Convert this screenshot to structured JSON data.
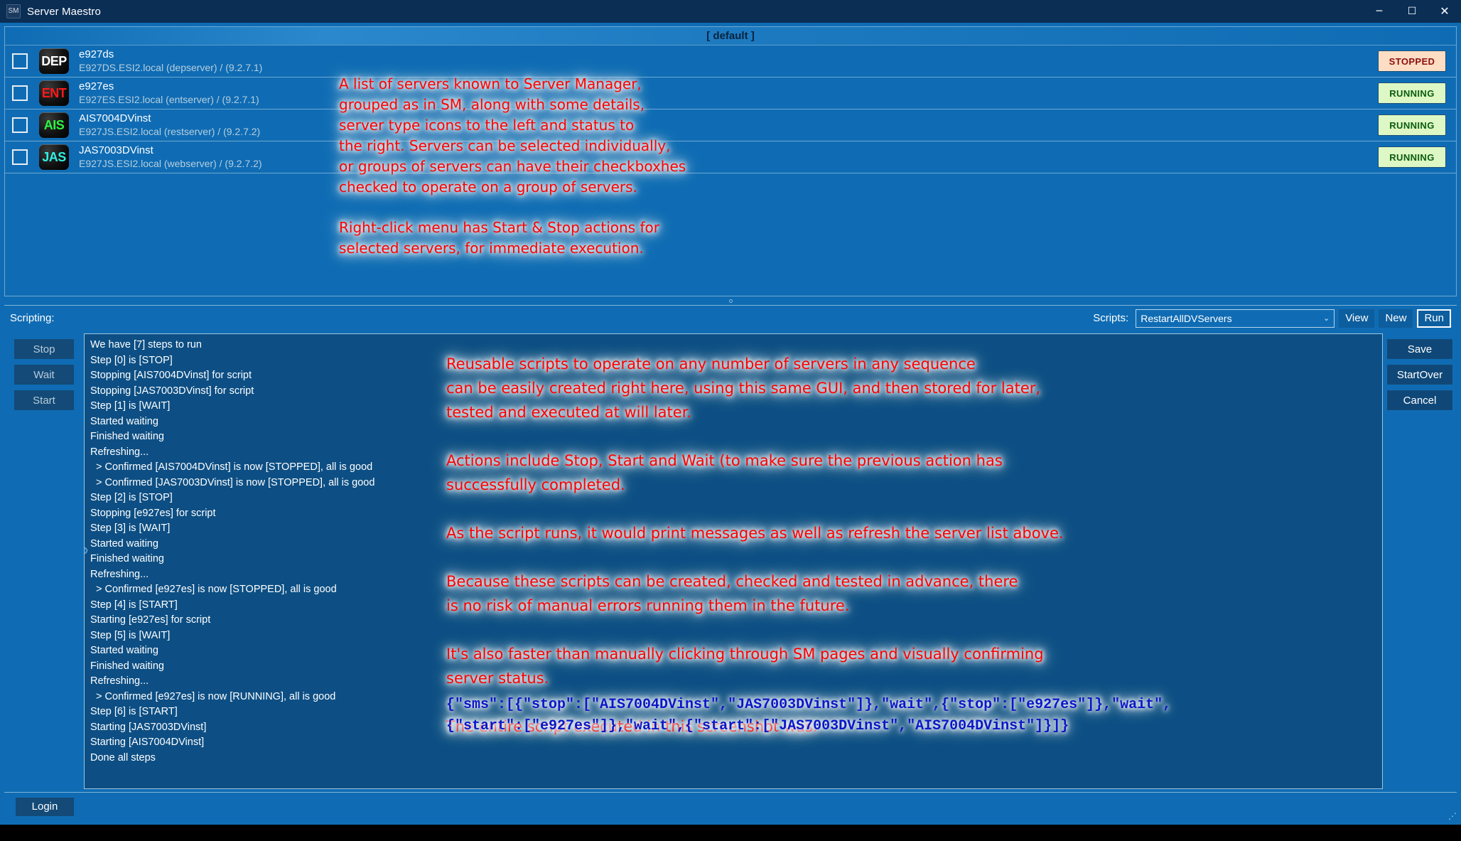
{
  "window": {
    "title": "Server Maestro",
    "app_icon": "server-maestro-icon",
    "minimize": "─",
    "maximize": "☐",
    "close": "✕",
    "resize_grip": "⋰"
  },
  "server_list": {
    "group_header": "[ default ]",
    "rows": [
      {
        "name": "e927ds",
        "detail": "E927DS.ESI2.local (depserver) / (9.2.7.1)",
        "icon_text": "DEP",
        "icon_color": "#ffffff",
        "status": "STOPPED",
        "status_kind": "stopped",
        "checked": false
      },
      {
        "name": "e927es",
        "detail": "E927ES.ESI2.local (entserver) / (9.2.7.1)",
        "icon_text": "ENT",
        "icon_color": "#ff1a1a",
        "status": "RUNNING",
        "status_kind": "running",
        "checked": false
      },
      {
        "name": "AIS7004DVinst",
        "detail": "E927JS.ESI2.local (restserver) / (9.2.7.2)",
        "icon_text": "AIS",
        "icon_color": "#2bf542",
        "status": "RUNNING",
        "status_kind": "running",
        "checked": false
      },
      {
        "name": "JAS7003DVinst",
        "detail": "E927JS.ESI2.local (webserver) / (9.2.7.2)",
        "icon_text": "JAS",
        "icon_color": "#2ff0e0",
        "status": "RUNNING",
        "status_kind": "running",
        "checked": false
      }
    ]
  },
  "scripting": {
    "section_label": "Scripting:",
    "scripts_label": "Scripts:",
    "selected_script": "RestartAllDVServers",
    "chevron": "⌄",
    "view_label": "View",
    "new_label": "New",
    "run_label": "Run",
    "left_actions": [
      "Stop",
      "Wait",
      "Start"
    ],
    "right_actions": [
      "Save",
      "StartOver",
      "Cancel"
    ],
    "log": "We have [7] steps to run\nStep [0] is [STOP]\nStopping [AIS7004DVinst] for script\nStopping [JAS7003DVinst] for script\nStep [1] is [WAIT]\nStarted waiting\nFinished waiting\nRefreshing...\n  > Confirmed [AIS7004DVinst] is now [STOPPED], all is good\n  > Confirmed [JAS7003DVinst] is now [STOPPED], all is good\nStep [2] is [STOP]\nStopping [e927es] for script\nStep [3] is [WAIT]\nStarted waiting\nFinished waiting\nRefreshing...\n  > Confirmed [e927es] is now [STOPPED], all is good\nStep [4] is [START]\nStarting [e927es] for script\nStep [5] is [WAIT]\nStarted waiting\nFinished waiting\nRefreshing...\n  > Confirmed [e927es] is now [RUNNING], all is good\nStep [6] is [START]\nStarting [JAS7003DVinst]\nStarting [AIS7004DVinst]\nDone all steps"
  },
  "bottom": {
    "login_label": "Login"
  },
  "annotations": {
    "server_list_1": "A list of servers known to Server Manager,\ngrouped as in SM, along with some details,\nserver type icons to the left and status to\nthe right. Servers can be selected individually,\nor groups of servers can have their checkboxhes\nchecked to operate on a group of servers.",
    "server_list_2": "Right-click menu has Start & Stop actions for\nselected servers, for immediate execution.",
    "scripting": "Reusable scripts to operate on any number of servers in any sequence\ncan be easily created right here, using this same GUI, and then stored for later,\ntested and executed at will later.\n\nActions include Stop, Start and Wait (to make sure the previous action has\nsuccessfully completed.\n\nAs the script runs, it would print messages as well as refresh the server list above.\n\nBecause these scripts can be created, checked and tested in advance, there\nis no risk of manual errors running them in the future.\n\nIt's also faster than manually clicking through SM pages and visually confirming\nserver status.\n\nThe entire script executed in this screenshot was:",
    "script_json": "{\"sms\":[{\"stop\":[\"AIS7004DVinst\",\"JAS7003DVinst\"]},\"wait\",{\"stop\":[\"e927es\"]},\"wait\",\n{\"start\":[\"e927es\"]},\"wait\",{\"start\":[\"JAS7003DVinst\",\"AIS7004DVinst\"]}]}"
  },
  "colors": {
    "window_bg": "#0f6cb4",
    "titlebar_bg": "#0b2e55",
    "accent_text": "#ffffff",
    "annotation_red": "#fe0000",
    "annotation_blue": "#0b16c8",
    "status_stopped_bg": "#fdddc4",
    "status_stopped_fg": "#8c0f0f",
    "status_running_bg": "#ddf8c4",
    "status_running_fg": "#0b5c11"
  }
}
